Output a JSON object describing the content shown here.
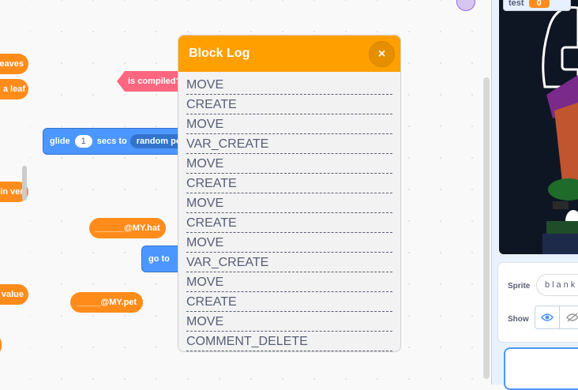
{
  "palette": {
    "blocks": [
      "eaves",
      "g a leaf",
      "e in ven",
      "value"
    ]
  },
  "workspace": {
    "is_compiled_label": "is compiled?",
    "glide": {
      "prefix": "glide",
      "secs_value": "1",
      "secs_label": "secs to",
      "target": "random po"
    },
    "my_hat_label": "______@MY.hat",
    "go_to_label": "go to",
    "my_pet_label": "_____@MY.pet"
  },
  "modal": {
    "title": "Block Log",
    "close_symbol": "×",
    "items": [
      "MOVE",
      "CREATE",
      "MOVE",
      "VAR_CREATE",
      "MOVE",
      "CREATE",
      "MOVE",
      "CREATE",
      "MOVE",
      "VAR_CREATE",
      "MOVE",
      "CREATE",
      "MOVE",
      "COMMENT_DELETE"
    ]
  },
  "stage": {
    "monitor_label": "test",
    "monitor_value": "0"
  },
  "sprite_panel": {
    "sprite_label": "Sprite",
    "sprite_name": "blank",
    "show_label": "Show"
  },
  "colors": {
    "accent": "#ff9f00",
    "blocks_orange": "#ff8c1a",
    "blocks_blue": "#4c97ff",
    "boolean_pink": "#ff6680"
  }
}
